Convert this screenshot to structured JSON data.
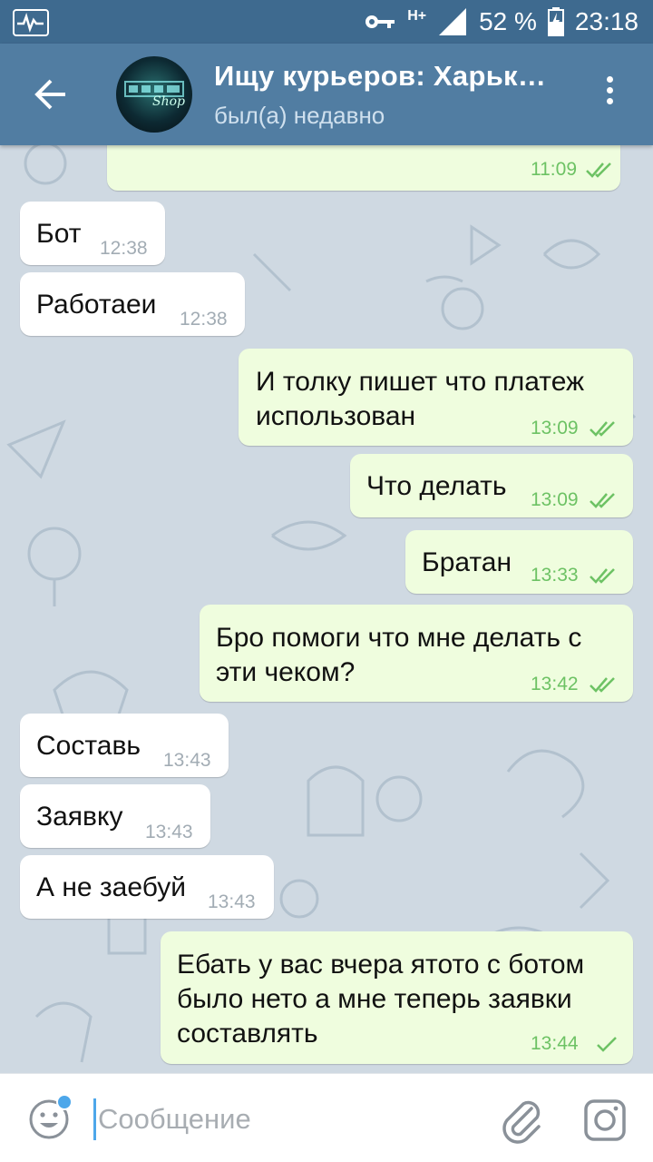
{
  "status_bar": {
    "network": "H+",
    "battery": "52 %",
    "time": "23:18"
  },
  "header": {
    "title": "Ищу курьеров: Харьк…",
    "status": "был(а) недавно",
    "avatar_text": "Shop"
  },
  "messages": [
    {
      "dir": "out",
      "text": "",
      "time": "11:09",
      "ticks": "double"
    },
    {
      "dir": "in",
      "text": "Бот",
      "time": "12:38"
    },
    {
      "dir": "in",
      "text": "Работаеи",
      "time": "12:38"
    },
    {
      "dir": "out",
      "lines": [
        "И толку пишет что платеж",
        "использован"
      ],
      "time": "13:09",
      "ticks": "double"
    },
    {
      "dir": "out",
      "text": "Что делать",
      "time": "13:09",
      "ticks": "double"
    },
    {
      "dir": "out",
      "text": "Братан",
      "time": "13:33",
      "ticks": "double"
    },
    {
      "dir": "out",
      "lines": [
        "Бро помоги что мне делать с",
        "эти чеком?"
      ],
      "time": "13:42",
      "ticks": "double"
    },
    {
      "dir": "in",
      "text": "Составь",
      "time": "13:43"
    },
    {
      "dir": "in",
      "text": "Заявку",
      "time": "13:43"
    },
    {
      "dir": "in",
      "text": "А не заебуй",
      "time": "13:43"
    },
    {
      "dir": "out",
      "lines": [
        "Ебать у вас вчера ятото с ботом",
        "было нето а мне теперь заявки",
        "составлять"
      ],
      "time": "13:44",
      "ticks": "single"
    }
  ],
  "composer": {
    "placeholder": "Сообщение"
  },
  "colors": {
    "header": "#517da2",
    "status_bar": "#3e6a8f",
    "outgoing_bubble": "#effdde",
    "incoming_bubble": "#ffffff",
    "tick": "#6dc264",
    "accent": "#4da7ea"
  },
  "icons": [
    "back-arrow-icon",
    "more-vert-icon",
    "emoji-icon",
    "paperclip-icon",
    "camera-icon",
    "key-icon",
    "signal-icon",
    "battery-icon"
  ]
}
